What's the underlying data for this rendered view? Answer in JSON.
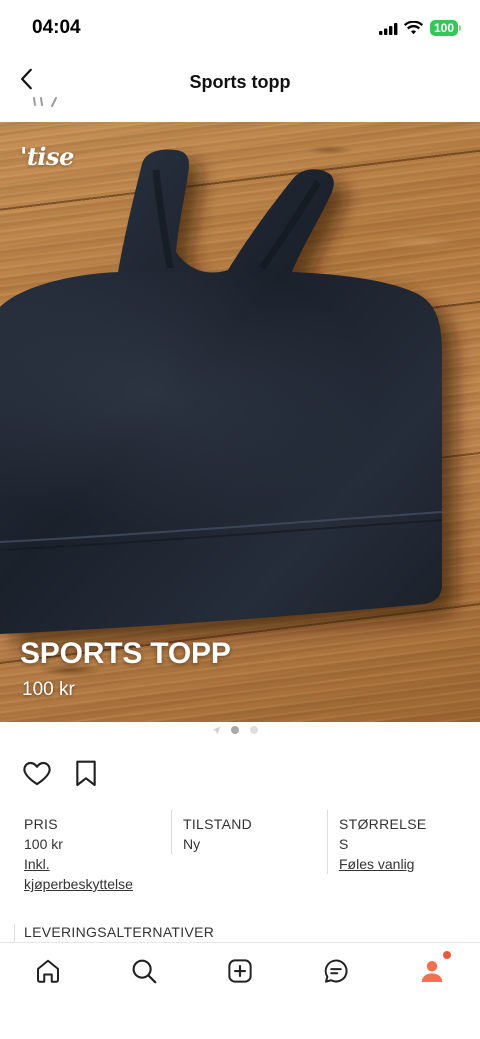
{
  "status_bar": {
    "time": "04:04",
    "battery_level": "100",
    "icons": [
      "signal-icon",
      "wifi-icon",
      "battery-icon"
    ]
  },
  "nav": {
    "back_icon": "chevron-left-icon",
    "title": "Sports topp"
  },
  "listing_image": {
    "logo": "'tise",
    "overlay_title": "SPORTS TOPP",
    "overlay_price": "100 kr",
    "page_indicator": {
      "lead_icon": "location-arrow-icon",
      "dots": 2,
      "active_dot": 0
    }
  },
  "actions": {
    "like_icon": "heart-icon",
    "save_icon": "bookmark-icon"
  },
  "details": {
    "price": {
      "label": "PRIS",
      "value": "100 kr",
      "link": "Inkl. kjøperbeskyttelse"
    },
    "condition": {
      "label": "TILSTAND",
      "value": "Ny"
    },
    "size": {
      "label": "STØRRELSE",
      "value": "S",
      "link": "Føles vanlig"
    }
  },
  "delivery": {
    "heading": "LEVERINGSALTERNATIVER"
  },
  "tab_bar": {
    "items": [
      {
        "icon": "home-icon"
      },
      {
        "icon": "search-icon"
      },
      {
        "icon": "plus-square-icon"
      },
      {
        "icon": "chat-icon"
      },
      {
        "icon": "profile-icon",
        "badge": true
      }
    ]
  },
  "colors": {
    "accent": "#f4704f",
    "badge": "#e9573f",
    "text": "#222222",
    "battery": "#34c759",
    "wood": "#b37a3f",
    "garment": "#1d232d"
  }
}
